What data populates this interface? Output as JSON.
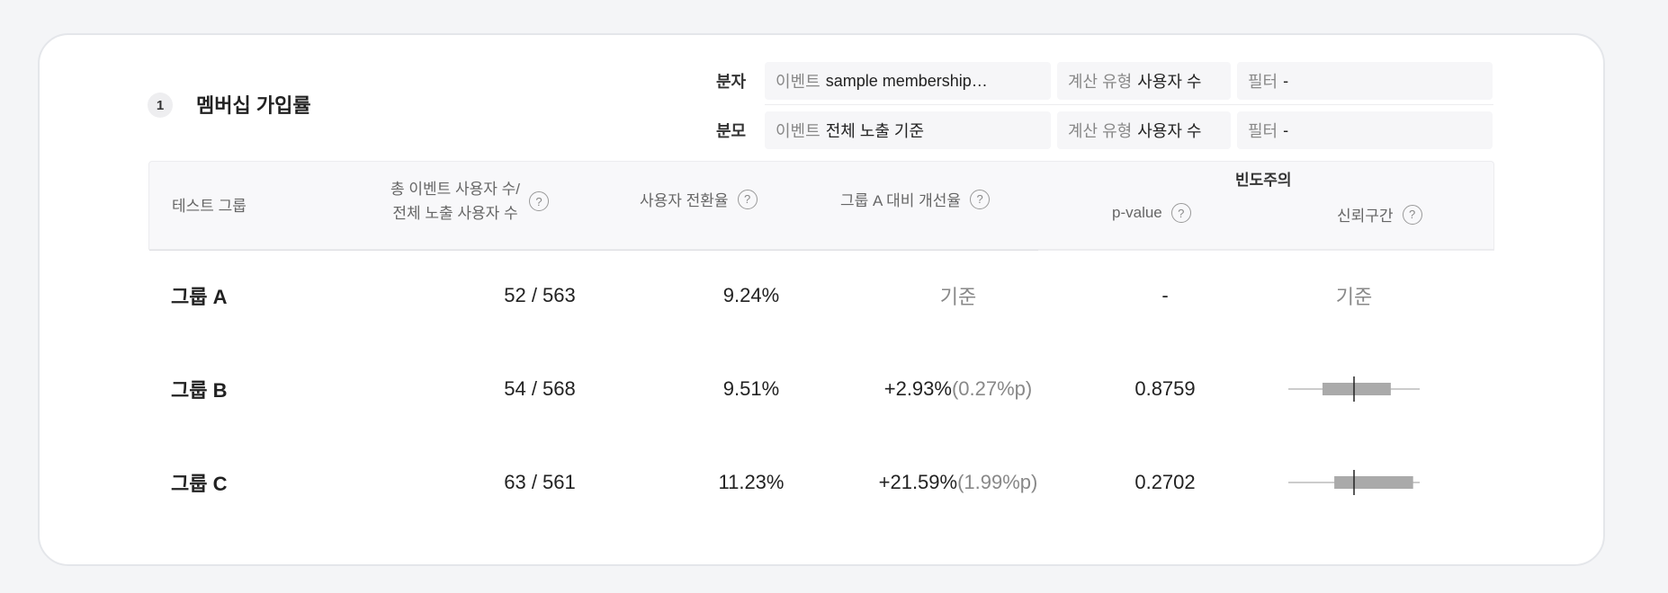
{
  "section": {
    "number": "1",
    "title": "멤버십 가입률"
  },
  "numerator": {
    "label": "분자",
    "event_key": "이벤트",
    "event_value": "sample    membership…",
    "calc_key": "계산 유형",
    "calc_value": "사용자 수",
    "filter_key": "필터",
    "filter_value": "-"
  },
  "denominator": {
    "label": "분모",
    "event_key": "이벤트",
    "event_value": "전체 노출 기준",
    "calc_key": "계산 유형",
    "calc_value": "사용자 수",
    "filter_key": "필터",
    "filter_value": "-"
  },
  "table": {
    "headers": {
      "group": "테스트 그룹",
      "counts_line1": "총 이벤트 사용자 수/",
      "counts_line2": "전체 노출 사용자 수",
      "conversion": "사용자 전환율",
      "improvement": "그룹 A 대비 개선율",
      "frequentist": "빈도주의",
      "pvalue": "p-value",
      "ci": "신뢰구간"
    },
    "rows": [
      {
        "group": "그룹 A",
        "counts": "52 / 563",
        "conversion": "9.24%",
        "improvement": "기준",
        "improvement_pp": "",
        "pvalue": "-",
        "ci_label": "기준",
        "ci": null
      },
      {
        "group": "그룹 B",
        "counts": "54 / 568",
        "conversion": "9.51%",
        "improvement": "+2.93%",
        "improvement_pp": "(0.27%p)",
        "pvalue": "0.8759",
        "ci_label": "",
        "ci": {
          "low": 0.25,
          "q1": 0.26,
          "point": 0.5,
          "q3": 0.78,
          "high": 1.0
        }
      },
      {
        "group": "그룹 C",
        "counts": "63 / 561",
        "conversion": "11.23%",
        "improvement": "+21.59%",
        "improvement_pp": "(1.99%p)",
        "pvalue": "0.2702",
        "ci_label": "",
        "ci": {
          "low": 0.0,
          "q1": 0.35,
          "point": 0.5,
          "q3": 0.95,
          "high": 1.0
        }
      }
    ]
  },
  "colors": {
    "ci_box": "#aaaaaa",
    "ci_line": "#999999",
    "ci_point": "#222222"
  }
}
